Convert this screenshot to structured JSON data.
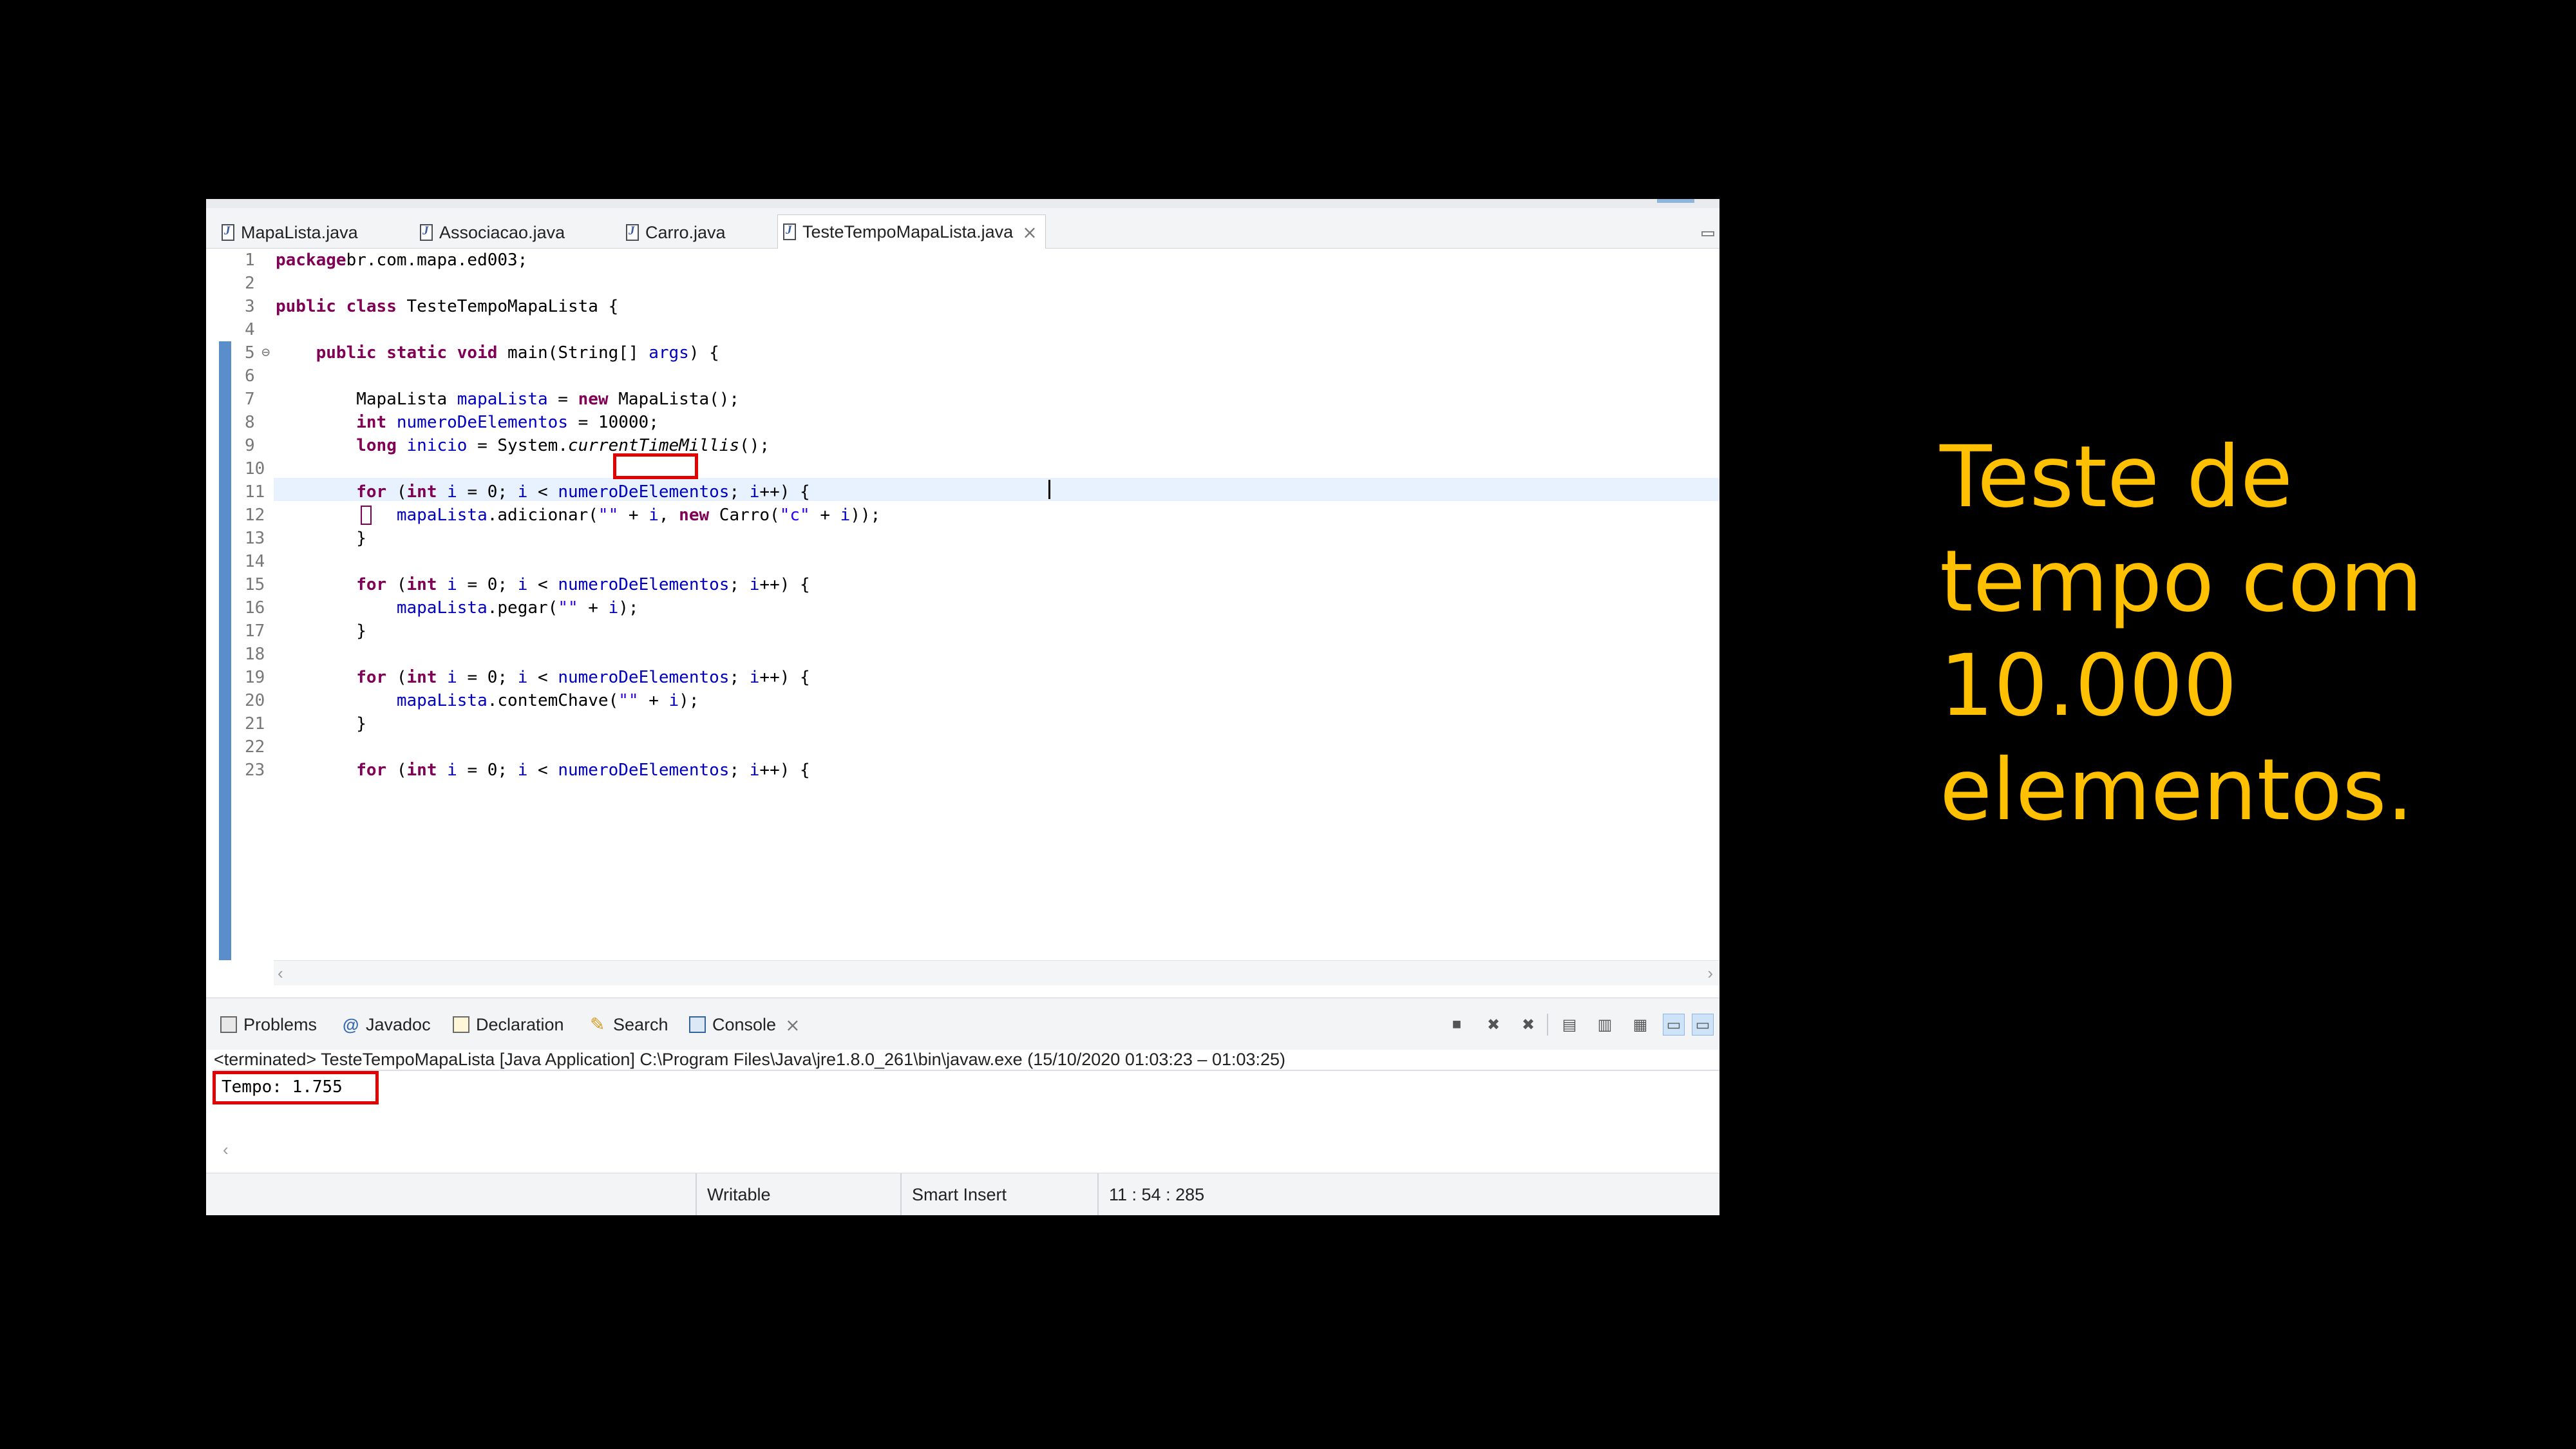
{
  "editor": {
    "tabs": [
      {
        "label": "MapaLista.java",
        "active": false
      },
      {
        "label": "Associacao.java",
        "active": false
      },
      {
        "label": "Carro.java",
        "active": false
      },
      {
        "label": "TesteTempoMapaLista.java",
        "active": true
      }
    ],
    "lines": [
      {
        "n": "1",
        "fold": "",
        "segs": [
          [
            "kw",
            "package"
          ],
          [
            "",
            "br.com.mapa.ed003;"
          ]
        ]
      },
      {
        "n": "2",
        "fold": "",
        "segs": []
      },
      {
        "n": "3",
        "fold": "",
        "segs": [
          [
            "kw",
            "public"
          ],
          [
            "",
            " "
          ],
          [
            "kw",
            "class"
          ],
          [
            "",
            " TesteTempoMapaLista {"
          ]
        ]
      },
      {
        "n": "4",
        "fold": "",
        "segs": []
      },
      {
        "n": "5",
        "fold": "⊖",
        "segs": [
          [
            "",
            "    "
          ],
          [
            "kw",
            "public"
          ],
          [
            "",
            " "
          ],
          [
            "kw",
            "static"
          ],
          [
            "",
            " "
          ],
          [
            "kw",
            "void"
          ],
          [
            "",
            " main(String[] "
          ],
          [
            "fld",
            "args"
          ],
          [
            "",
            ") {"
          ]
        ]
      },
      {
        "n": "6",
        "fold": "",
        "segs": []
      },
      {
        "n": "7",
        "fold": "",
        "segs": [
          [
            "",
            "        MapaLista "
          ],
          [
            "fld",
            "mapaLista"
          ],
          [
            "",
            " = "
          ],
          [
            "kw",
            "new"
          ],
          [
            "",
            " MapaLista();"
          ]
        ]
      },
      {
        "n": "8",
        "fold": "",
        "segs": [
          [
            "",
            "        "
          ],
          [
            "kw",
            "int"
          ],
          [
            "",
            " "
          ],
          [
            "fld",
            "numeroDeElementos"
          ],
          [
            "",
            " = 10000;"
          ]
        ]
      },
      {
        "n": "9",
        "fold": "",
        "segs": [
          [
            "",
            "        "
          ],
          [
            "kw",
            "long"
          ],
          [
            "",
            " "
          ],
          [
            "fld",
            "inicio"
          ],
          [
            "",
            " = System."
          ],
          [
            "it",
            "currentTimeMillis"
          ],
          [
            "",
            "();"
          ]
        ]
      },
      {
        "n": "10",
        "fold": "",
        "segs": []
      },
      {
        "n": "11",
        "fold": "",
        "segs": [
          [
            "",
            "        "
          ],
          [
            "kw",
            "for"
          ],
          [
            "",
            " ("
          ],
          [
            "kw",
            "int"
          ],
          [
            "",
            " "
          ],
          [
            "fld",
            "i"
          ],
          [
            "",
            " = 0; "
          ],
          [
            "fld",
            "i"
          ],
          [
            "",
            " < "
          ],
          [
            "fld",
            "numeroDeElementos"
          ],
          [
            "",
            "; "
          ],
          [
            "fld",
            "i"
          ],
          [
            "",
            "++) {"
          ]
        ]
      },
      {
        "n": "12",
        "fold": "",
        "segs": [
          [
            "",
            "            "
          ],
          [
            "fld",
            "mapaLista"
          ],
          [
            "",
            ".adicionar("
          ],
          [
            "str",
            "\"\""
          ],
          [
            "",
            " + "
          ],
          [
            "fld",
            "i"
          ],
          [
            "",
            ", "
          ],
          [
            "kw",
            "new"
          ],
          [
            "",
            " Carro("
          ],
          [
            "str",
            "\"c\""
          ],
          [
            "",
            " + "
          ],
          [
            "fld",
            "i"
          ],
          [
            "",
            "));"
          ]
        ]
      },
      {
        "n": "13",
        "fold": "",
        "segs": [
          [
            "",
            "        }"
          ]
        ]
      },
      {
        "n": "14",
        "fold": "",
        "segs": []
      },
      {
        "n": "15",
        "fold": "",
        "segs": [
          [
            "",
            "        "
          ],
          [
            "kw",
            "for"
          ],
          [
            "",
            " ("
          ],
          [
            "kw",
            "int"
          ],
          [
            "",
            " "
          ],
          [
            "fld",
            "i"
          ],
          [
            "",
            " = 0; "
          ],
          [
            "fld",
            "i"
          ],
          [
            "",
            " < "
          ],
          [
            "fld",
            "numeroDeElementos"
          ],
          [
            "",
            "; "
          ],
          [
            "fld",
            "i"
          ],
          [
            "",
            "++) {"
          ]
        ]
      },
      {
        "n": "16",
        "fold": "",
        "segs": [
          [
            "",
            "            "
          ],
          [
            "fld",
            "mapaLista"
          ],
          [
            "",
            ".pegar("
          ],
          [
            "str",
            "\"\""
          ],
          [
            "",
            " + "
          ],
          [
            "fld",
            "i"
          ],
          [
            "",
            ");"
          ]
        ]
      },
      {
        "n": "17",
        "fold": "",
        "segs": [
          [
            "",
            "        }"
          ]
        ]
      },
      {
        "n": "18",
        "fold": "",
        "segs": []
      },
      {
        "n": "19",
        "fold": "",
        "segs": [
          [
            "",
            "        "
          ],
          [
            "kw",
            "for"
          ],
          [
            "",
            " ("
          ],
          [
            "kw",
            "int"
          ],
          [
            "",
            " "
          ],
          [
            "fld",
            "i"
          ],
          [
            "",
            " = 0; "
          ],
          [
            "fld",
            "i"
          ],
          [
            "",
            " < "
          ],
          [
            "fld",
            "numeroDeElementos"
          ],
          [
            "",
            "; "
          ],
          [
            "fld",
            "i"
          ],
          [
            "",
            "++) {"
          ]
        ]
      },
      {
        "n": "20",
        "fold": "",
        "segs": [
          [
            "",
            "            "
          ],
          [
            "fld",
            "mapaLista"
          ],
          [
            "",
            ".contemChave("
          ],
          [
            "str",
            "\"\""
          ],
          [
            "",
            " + "
          ],
          [
            "fld",
            "i"
          ],
          [
            "",
            ");"
          ]
        ]
      },
      {
        "n": "21",
        "fold": "",
        "segs": [
          [
            "",
            "        }"
          ]
        ]
      },
      {
        "n": "22",
        "fold": "",
        "segs": []
      },
      {
        "n": "23",
        "fold": "",
        "segs": [
          [
            "",
            "        "
          ],
          [
            "kw",
            "for"
          ],
          [
            "",
            " ("
          ],
          [
            "kw",
            "int"
          ],
          [
            "",
            " "
          ],
          [
            "fld",
            "i"
          ],
          [
            "",
            " = 0; "
          ],
          [
            "fld",
            "i"
          ],
          [
            "",
            " < "
          ],
          [
            "fld",
            "numeroDeElementos"
          ],
          [
            "",
            "; "
          ],
          [
            "fld",
            "i"
          ],
          [
            "",
            "++) {"
          ]
        ]
      }
    ]
  },
  "views": {
    "tabs": [
      {
        "label": "Problems",
        "icon": "problems-icon"
      },
      {
        "label": "Javadoc",
        "icon": "javadoc-icon"
      },
      {
        "label": "Declaration",
        "icon": "declaration-icon"
      },
      {
        "label": "Search",
        "icon": "search-icon"
      },
      {
        "label": "Console",
        "icon": "console-icon",
        "active": true
      }
    ],
    "console_header": "<terminated> TesteTempoMapaLista [Java Application] C:\\Program Files\\Java\\jre1.8.0_261\\bin\\javaw.exe  (15/10/2020 01:03:23 – 01:03:25)",
    "console_output": "Tempo: 1.755"
  },
  "statusbar": {
    "mode": "Writable",
    "insert": "Smart Insert",
    "position": "11 : 54 : 285"
  },
  "caption": {
    "lines": [
      "Teste de",
      "tempo com",
      "10.000",
      "elementos."
    ]
  },
  "colors": {
    "caption": "#ffc000",
    "highlight_box": "#e00000",
    "keyword": "#7f0055",
    "field": "#0000c0",
    "string": "#2a00ff"
  }
}
